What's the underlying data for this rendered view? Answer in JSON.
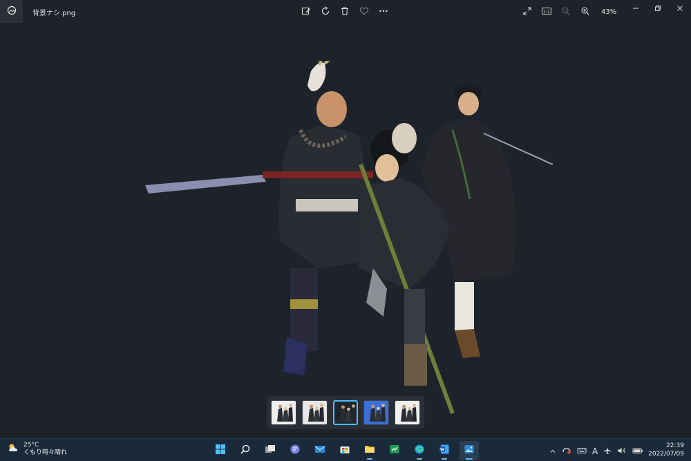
{
  "window": {
    "filename": "背景ナシ.png",
    "zoom": "43%",
    "toolbar": [
      {
        "icon": "edit-image-icon"
      },
      {
        "icon": "rotate-icon"
      },
      {
        "icon": "delete-icon"
      },
      {
        "icon": "favorite-heart-icon"
      },
      {
        "icon": "more-options-icon"
      }
    ],
    "right_tools": [
      {
        "icon": "fullscreen-icon"
      },
      {
        "icon": "actual-size-icon",
        "label": "1:1"
      },
      {
        "icon": "zoom-out-icon"
      },
      {
        "icon": "zoom-in-icon"
      }
    ]
  },
  "filmstrip": {
    "count": 5,
    "selected_index": 2,
    "thumb_colors": [
      "#eeeeee",
      "#e6e6e6",
      "#20252c",
      "#3a6fd8",
      "#f0f0f0"
    ]
  },
  "taskbar": {
    "weather": {
      "temp": "25°C",
      "condition": "くもり時々晴れ"
    },
    "apps": [
      {
        "icon": "windows-start-icon"
      },
      {
        "icon": "search-icon"
      },
      {
        "icon": "task-view-icon"
      },
      {
        "icon": "teams-chat-icon"
      },
      {
        "icon": "mail-icon"
      },
      {
        "icon": "microsoft-store-icon"
      },
      {
        "icon": "file-explorer-icon"
      },
      {
        "icon": "green-app-icon"
      },
      {
        "icon": "edge-icon"
      },
      {
        "icon": "word-icon"
      },
      {
        "icon": "photos-icon",
        "active": true
      }
    ],
    "tray": {
      "icons": [
        "show-hidden-icons-chevron",
        "security-icon",
        "keyboard-icon",
        "ime-icon",
        "airplane-mode-icon",
        "volume-icon",
        "battery-icon"
      ],
      "ime_label": "A"
    },
    "clock": {
      "time": "22:39",
      "date": "2022/07/09"
    }
  },
  "colors": {
    "background": "#1e232b",
    "taskbar": "#1b2a3a",
    "accent": "#4cc2ff"
  }
}
